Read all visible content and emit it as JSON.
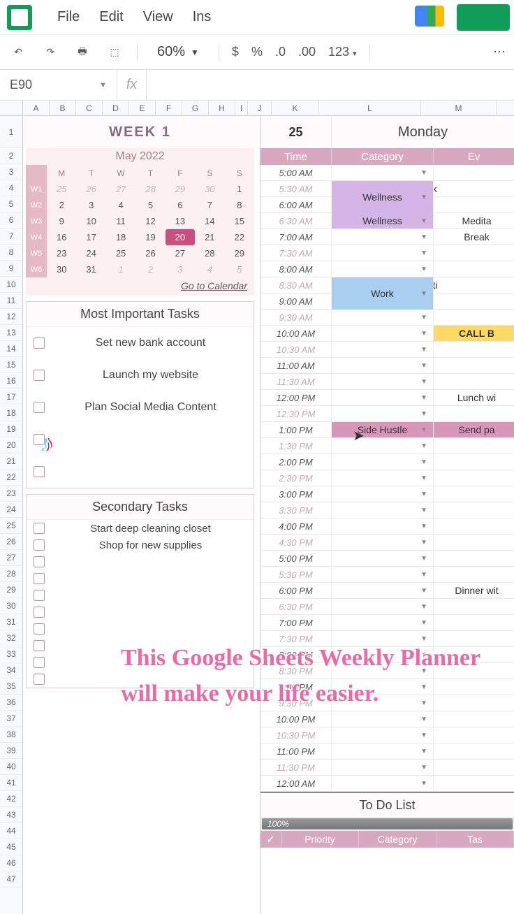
{
  "menubar": {
    "file": "File",
    "edit": "Edit",
    "view": "View",
    "insert": "Ins"
  },
  "toolbar": {
    "zoom": "60%",
    "currency": "$",
    "percent": "%",
    "dec_dec": ".0",
    "dec_inc": ".00",
    "numfmt": "123"
  },
  "formula": {
    "namebox": "E90",
    "fx": "fx"
  },
  "cols": [
    "A",
    "B",
    "C",
    "D",
    "E",
    "F",
    "G",
    "H",
    "I",
    "J",
    "K",
    "L",
    "M"
  ],
  "left": {
    "week_title": "WEEK 1",
    "minical": {
      "title": "May 2022",
      "dow": [
        "M",
        "T",
        "W",
        "T",
        "F",
        "S",
        "S"
      ],
      "weeks": [
        {
          "wk": "W1",
          "days": [
            {
              "n": "25",
              "out": true
            },
            {
              "n": "26",
              "out": true
            },
            {
              "n": "27",
              "out": true
            },
            {
              "n": "28",
              "out": true
            },
            {
              "n": "29",
              "out": true
            },
            {
              "n": "30",
              "out": true
            },
            {
              "n": "1"
            }
          ]
        },
        {
          "wk": "W2",
          "days": [
            {
              "n": "2"
            },
            {
              "n": "3"
            },
            {
              "n": "4"
            },
            {
              "n": "5"
            },
            {
              "n": "6"
            },
            {
              "n": "7"
            },
            {
              "n": "8"
            }
          ]
        },
        {
          "wk": "W3",
          "days": [
            {
              "n": "9"
            },
            {
              "n": "10"
            },
            {
              "n": "11"
            },
            {
              "n": "12"
            },
            {
              "n": "13"
            },
            {
              "n": "14"
            },
            {
              "n": "15"
            }
          ]
        },
        {
          "wk": "W4",
          "days": [
            {
              "n": "16"
            },
            {
              "n": "17"
            },
            {
              "n": "18"
            },
            {
              "n": "19"
            },
            {
              "n": "20",
              "sel": true
            },
            {
              "n": "21"
            },
            {
              "n": "22"
            }
          ]
        },
        {
          "wk": "W5",
          "days": [
            {
              "n": "23"
            },
            {
              "n": "24"
            },
            {
              "n": "25"
            },
            {
              "n": "26"
            },
            {
              "n": "27"
            },
            {
              "n": "28"
            },
            {
              "n": "29"
            }
          ]
        },
        {
          "wk": "W6",
          "days": [
            {
              "n": "30"
            },
            {
              "n": "31"
            },
            {
              "n": "1",
              "out": true
            },
            {
              "n": "2",
              "out": true
            },
            {
              "n": "3",
              "out": true
            },
            {
              "n": "4",
              "out": true
            },
            {
              "n": "5",
              "out": true
            }
          ]
        }
      ],
      "link": "Go to Calendar"
    },
    "important": {
      "title": "Most Important Tasks",
      "items": [
        "Set new bank account",
        "Launch my website",
        "Plan Social Media Content",
        "",
        ""
      ]
    },
    "secondary": {
      "title": "Secondary Tasks",
      "items": [
        "Start deep cleaning closet",
        "Shop for new supplies",
        "",
        "",
        "",
        "",
        "",
        "",
        "",
        ""
      ]
    }
  },
  "right": {
    "date": "25",
    "day": "Monday",
    "hdr": {
      "time": "Time",
      "cat": "Category",
      "ev": "Ev"
    },
    "rows": [
      {
        "t": "5:00 AM"
      },
      {
        "t": "5:30 AM",
        "muted": true,
        "cat": "Wellness",
        "catcls": "cat-wellness",
        "catspan": 2,
        "ev": "Work"
      },
      {
        "t": "6:00 AM"
      },
      {
        "t": "6:30 AM",
        "muted": true,
        "cat": "Wellness",
        "catcls": "cat-wellness",
        "ev": "Medita"
      },
      {
        "t": "7:00 AM",
        "ev": "Break"
      },
      {
        "t": "7:30 AM",
        "muted": true
      },
      {
        "t": "8:00 AM"
      },
      {
        "t": "8:30 AM",
        "muted": true,
        "cat": "Work",
        "catcls": "cat-work",
        "catspan": 2,
        "ev": "Meeti"
      },
      {
        "t": "9:00 AM"
      },
      {
        "t": "9:30 AM",
        "muted": true
      },
      {
        "t": "10:00 AM",
        "ev": "CALL B",
        "evcls": "ev-call"
      },
      {
        "t": "10:30 AM",
        "muted": true
      },
      {
        "t": "11:00 AM"
      },
      {
        "t": "11:30 AM",
        "muted": true
      },
      {
        "t": "12:00 PM",
        "ev": "Lunch wi"
      },
      {
        "t": "12:30 PM",
        "muted": true
      },
      {
        "t": "1:00 PM",
        "cat": "Side Hustle",
        "catcls": "cat-side",
        "ev": "Send pa",
        "evcls": "ev-side"
      },
      {
        "t": "1:30 PM",
        "muted": true
      },
      {
        "t": "2:00 PM"
      },
      {
        "t": "2:30 PM",
        "muted": true
      },
      {
        "t": "3:00 PM"
      },
      {
        "t": "3:30 PM",
        "muted": true
      },
      {
        "t": "4:00 PM"
      },
      {
        "t": "4:30 PM",
        "muted": true
      },
      {
        "t": "5:00 PM"
      },
      {
        "t": "5:30 PM",
        "muted": true
      },
      {
        "t": "6:00 PM",
        "ev": "Dinner wit",
        "evspan": 2
      },
      {
        "t": "6:30 PM",
        "muted": true
      },
      {
        "t": "7:00 PM"
      },
      {
        "t": "7:30 PM",
        "muted": true
      },
      {
        "t": "8:00 PM"
      },
      {
        "t": "8:30 PM",
        "muted": true
      },
      {
        "t": "9:00 PM"
      },
      {
        "t": "9:30 PM",
        "muted": true
      },
      {
        "t": "10:00 PM"
      },
      {
        "t": "10:30 PM",
        "muted": true
      },
      {
        "t": "11:00 PM"
      },
      {
        "t": "11:30 PM",
        "muted": true
      },
      {
        "t": "12:00 AM"
      }
    ],
    "todo": {
      "title": "To Do List",
      "pct": "100%",
      "cols": [
        "✓",
        "Priority",
        "Category",
        "Tas"
      ]
    }
  },
  "overlay": "This Google Sheets Weekly Planner will make your life easier."
}
